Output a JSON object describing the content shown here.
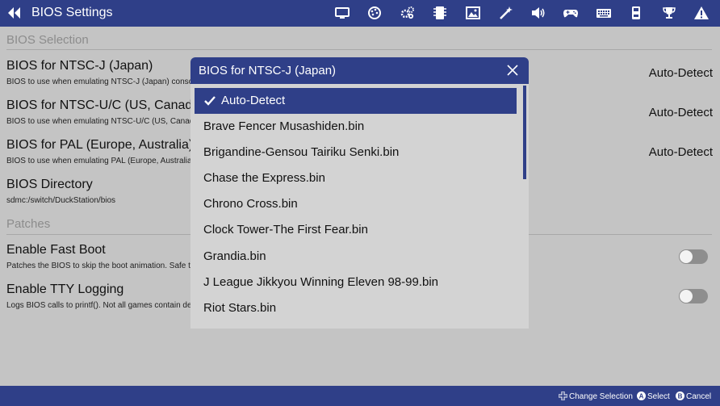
{
  "header": {
    "title": "BIOS Settings",
    "icons": [
      "display-icon",
      "palette-icon",
      "gears-icon",
      "chip-icon",
      "image-icon",
      "magic-wand-icon",
      "speaker-icon",
      "gamepad-icon",
      "keyboard-icon",
      "memory-card-icon",
      "trophy-icon",
      "warning-icon"
    ],
    "active_icon": "chip-icon"
  },
  "sections": {
    "bios_selection": "BIOS Selection",
    "patches": "Patches"
  },
  "settings": {
    "ntsc_j": {
      "title": "BIOS for NTSC-J (Japan)",
      "desc": "BIOS to use when emulating NTSC-J (Japan) consoles.",
      "value": "Auto-Detect"
    },
    "ntsc_u": {
      "title": "BIOS for NTSC-U/C (US, Canada)",
      "desc": "BIOS to use when emulating NTSC-U/C (US, Canada) consoles.",
      "value": "Auto-Detect"
    },
    "pal": {
      "title": "BIOS for PAL (Europe, Australia)",
      "desc": "BIOS to use when emulating PAL (Europe, Australia) consoles.",
      "value": "Auto-Detect"
    },
    "bios_dir": {
      "title": "BIOS Directory",
      "desc": "sdmc:/switch/DuckStation/bios"
    },
    "fast_boot": {
      "title": "Enable Fast Boot",
      "desc": "Patches the BIOS to skip the boot animation. Safe to enable.",
      "enabled": false
    },
    "tty_logging": {
      "title": "Enable TTY Logging",
      "desc": "Logs BIOS calls to printf(). Not all games contain debugging messages.",
      "enabled": false
    }
  },
  "dialog": {
    "title": "BIOS for NTSC-J (Japan)",
    "options": [
      "Auto-Detect",
      "Brave Fencer Musashiden.bin",
      "Brigandine-Gensou Tairiku Senki.bin",
      "Chase the Express.bin",
      "Chrono Cross.bin",
      "Clock Tower-The First Fear.bin",
      "Grandia.bin",
      "J League Jikkyou Winning Eleven 98-99.bin",
      "Riot Stars.bin"
    ],
    "selected_index": 0
  },
  "footer": {
    "change_selection": "Change Selection",
    "select": "Select",
    "cancel": "Cancel"
  },
  "colors": {
    "accent": "#2f3f88",
    "background": "#c4c4c4",
    "dialog_bg": "#d3d3d3"
  }
}
